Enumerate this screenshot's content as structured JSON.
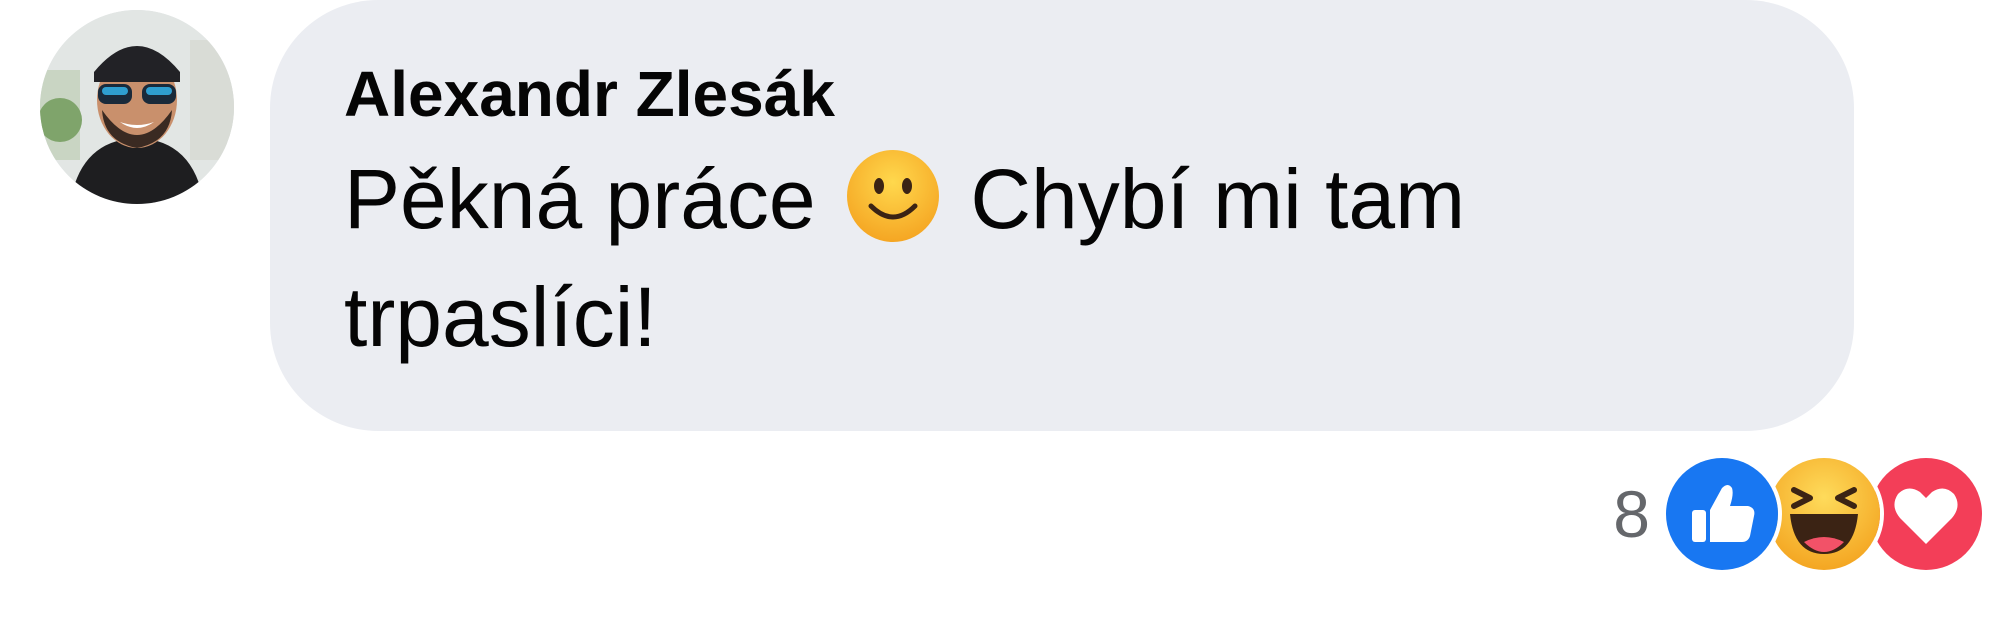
{
  "comment": {
    "author": "Alexandr Zlesák",
    "text_before_emoji": "Pěkná práce",
    "emoji": "slightly-smiling-face-icon",
    "text_after_emoji": "Chybí mi tam trpaslíci!"
  },
  "reactions": {
    "count": "8",
    "types": [
      "like-icon",
      "haha-icon",
      "love-icon"
    ]
  },
  "colors": {
    "bubble": "#ebedf2",
    "text": "#050505",
    "count": "#65676b",
    "like": "#1877f2",
    "haha": "#f7b125",
    "love": "#f33e58"
  }
}
